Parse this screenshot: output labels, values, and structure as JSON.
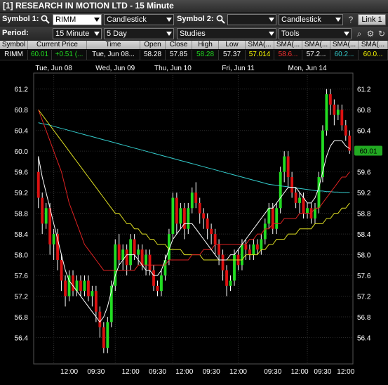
{
  "window": {
    "title": "[1] RESEARCH IN MOTION LTD - 15 Minute"
  },
  "toolbar": {
    "symbol1_label": "Symbol 1:",
    "symbol1_value": "RIMM",
    "chart_style1": "Candlestick",
    "symbol2_label": "Symbol 2:",
    "symbol2_value": "",
    "chart_style2": "Candlestick",
    "link_label": "Link 1",
    "period_label": "Period:",
    "period_value": "15 Minute",
    "range_value": "5 Day",
    "studies_value": "Studies",
    "tools_value": "Tools"
  },
  "quote_table": {
    "headers": [
      "Symbol",
      "Current Price",
      "Time",
      "Open",
      "Close",
      "High",
      "Low",
      "SMA(...",
      "SMA(...",
      "SMA(...",
      "SMA(...",
      "SMA(..."
    ],
    "row": [
      "RIMM",
      "60.01",
      "+0.51 (...",
      "Tue, Jun 08...",
      "58.28",
      "57.85",
      "58.28",
      "57.37",
      "57.014",
      "58.6...",
      "57.2...",
      "60.2...",
      "60.0..."
    ],
    "colors": {
      "symbol": "#ffffff",
      "price": "#22dd22",
      "change": "#22dd22",
      "time": "#ffffff",
      "open": "#ffffff",
      "close": "#ffffff",
      "high": "#22dd22",
      "low": "#ffffff",
      "sma1": "#ffff00",
      "sma2": "#ff3333",
      "sma3": "#ffffff",
      "sma4": "#33cccc",
      "sma5": "#ffff00"
    }
  },
  "chart_data": {
    "type": "candlestick",
    "y_ticks": [
      "61.2",
      "60.8",
      "60.4",
      "60.0",
      "59.6",
      "59.2",
      "58.8",
      "58.4",
      "58.0",
      "57.6",
      "57.2",
      "56.8",
      "56.4"
    ],
    "ylim": [
      56.0,
      61.4
    ],
    "top_date_labels": [
      "Tue, Jun 08",
      "Wed, Jun 09",
      "Thu, Jun 10",
      "Fri, Jun 11",
      "Mon, Jun 14"
    ],
    "bottom_time_labels": [
      "12:00",
      "09:30",
      "12:00",
      "09:30",
      "12:00",
      "09:30",
      "12:00",
      "09:30",
      "12:00",
      "09:30",
      "12:00"
    ],
    "last_price_label": "60.01",
    "colors": {
      "up": "#22dd22",
      "down": "#dd1111",
      "wick": "#ffffff",
      "grid": "#2a2a2a",
      "sma_white": "#ffffff",
      "sma_red": "#dd2222",
      "sma_yellow": "#dddd22",
      "sma_cyan": "#33cccc",
      "sma_yellow2": "#cccc22"
    },
    "candles": [
      [
        59.6,
        59.1,
        59.9,
        58.9
      ],
      [
        59.1,
        58.6,
        59.2,
        58.4
      ],
      [
        58.6,
        58.9,
        59.0,
        58.5
      ],
      [
        58.9,
        58.2,
        59.0,
        58.0
      ],
      [
        58.2,
        58.4,
        58.5,
        57.9
      ],
      [
        58.4,
        57.9,
        58.5,
        57.7
      ],
      [
        57.9,
        57.5,
        58.0,
        57.3
      ],
      [
        57.5,
        57.2,
        57.6,
        57.0
      ],
      [
        57.2,
        57.6,
        57.7,
        57.1
      ],
      [
        57.6,
        57.3,
        57.7,
        57.2
      ],
      [
        57.3,
        57.5,
        57.6,
        57.2
      ],
      [
        57.5,
        57.3,
        57.6,
        57.2
      ],
      [
        57.3,
        57.5,
        57.6,
        57.2
      ],
      [
        57.5,
        57.2,
        57.6,
        57.1
      ],
      [
        57.2,
        57.3,
        57.4,
        57.0
      ],
      [
        57.3,
        56.9,
        57.4,
        56.7
      ],
      [
        56.9,
        56.6,
        57.0,
        56.4
      ],
      [
        56.6,
        56.2,
        56.7,
        56.1
      ],
      [
        56.2,
        56.7,
        56.8,
        56.1
      ],
      [
        56.7,
        57.4,
        57.5,
        56.6
      ],
      [
        57.4,
        58.2,
        58.3,
        57.3
      ],
      [
        58.2,
        57.9,
        58.4,
        57.8
      ],
      [
        57.9,
        58.1,
        58.2,
        57.7
      ],
      [
        58.1,
        57.8,
        58.2,
        57.6
      ],
      [
        57.8,
        58.3,
        58.4,
        57.7
      ],
      [
        58.3,
        58.0,
        58.4,
        57.9
      ],
      [
        58.0,
        58.1,
        58.2,
        57.8
      ],
      [
        58.1,
        57.8,
        58.2,
        57.7
      ],
      [
        57.8,
        58.0,
        58.1,
        57.6
      ],
      [
        58.0,
        57.7,
        58.1,
        57.6
      ],
      [
        57.7,
        57.4,
        57.8,
        57.3
      ],
      [
        57.4,
        57.3,
        57.5,
        57.2
      ],
      [
        57.3,
        57.6,
        57.7,
        57.2
      ],
      [
        57.6,
        57.9,
        58.0,
        57.5
      ],
      [
        57.9,
        58.4,
        58.5,
        57.8
      ],
      [
        58.4,
        59.1,
        59.2,
        58.3
      ],
      [
        59.1,
        58.6,
        59.2,
        58.4
      ],
      [
        58.6,
        58.9,
        59.0,
        58.5
      ],
      [
        58.9,
        58.5,
        59.0,
        58.3
      ],
      [
        58.5,
        58.9,
        59.0,
        58.4
      ],
      [
        58.9,
        59.2,
        59.3,
        58.8
      ],
      [
        59.2,
        59.0,
        59.4,
        58.9
      ],
      [
        59.0,
        58.8,
        59.1,
        58.6
      ],
      [
        58.8,
        58.7,
        58.9,
        58.5
      ],
      [
        58.7,
        58.5,
        58.8,
        58.3
      ],
      [
        58.5,
        58.4,
        58.6,
        58.2
      ],
      [
        58.4,
        58.2,
        58.5,
        58.0
      ],
      [
        58.2,
        58.0,
        58.3,
        57.8
      ],
      [
        58.0,
        57.7,
        58.1,
        57.5
      ],
      [
        57.7,
        57.4,
        57.8,
        57.2
      ],
      [
        57.4,
        57.5,
        57.6,
        57.3
      ],
      [
        57.5,
        58.0,
        58.1,
        57.4
      ],
      [
        58.0,
        57.8,
        58.1,
        57.7
      ],
      [
        57.8,
        58.2,
        58.3,
        57.7
      ],
      [
        58.2,
        58.1,
        58.3,
        57.9
      ],
      [
        58.1,
        58.0,
        58.2,
        57.9
      ],
      [
        58.0,
        58.2,
        58.3,
        57.9
      ],
      [
        58.2,
        58.1,
        58.3,
        58.0
      ],
      [
        58.1,
        58.3,
        58.4,
        58.0
      ],
      [
        58.3,
        58.6,
        58.7,
        58.2
      ],
      [
        58.6,
        58.9,
        59.0,
        58.5
      ],
      [
        58.9,
        58.5,
        59.0,
        58.4
      ],
      [
        58.5,
        58.9,
        59.0,
        58.4
      ],
      [
        58.9,
        59.6,
        59.7,
        58.8
      ],
      [
        59.6,
        59.9,
        60.0,
        59.4
      ],
      [
        59.9,
        59.5,
        60.0,
        59.3
      ],
      [
        59.5,
        59.2,
        59.6,
        59.1
      ],
      [
        59.2,
        59.0,
        59.3,
        58.9
      ],
      [
        59.0,
        59.1,
        59.2,
        58.8
      ],
      [
        59.1,
        58.8,
        59.2,
        58.7
      ],
      [
        58.8,
        58.9,
        59.0,
        58.7
      ],
      [
        58.9,
        58.7,
        59.0,
        58.6
      ],
      [
        58.7,
        58.9,
        59.0,
        58.6
      ],
      [
        58.9,
        59.5,
        59.6,
        58.8
      ],
      [
        59.5,
        60.4,
        60.5,
        59.4
      ],
      [
        60.4,
        61.1,
        61.2,
        60.3
      ],
      [
        61.1,
        60.9,
        61.2,
        60.7
      ],
      [
        60.9,
        60.7,
        61.0,
        60.5
      ],
      [
        60.7,
        60.8,
        60.9,
        60.6
      ],
      [
        60.8,
        60.5,
        60.9,
        60.4
      ],
      [
        60.5,
        60.3,
        60.6,
        60.2
      ],
      [
        60.3,
        60.01,
        60.4,
        59.95
      ]
    ],
    "sma_white": [
      59.9,
      59.5,
      59.2,
      58.9,
      58.6,
      58.3,
      58.0,
      57.7,
      57.5,
      57.4,
      57.3,
      57.2,
      57.1,
      57.0,
      56.9,
      56.8,
      56.7,
      56.8,
      57.0,
      57.3,
      57.6,
      57.8,
      57.9,
      58.0,
      58.0,
      58.0,
      57.9,
      57.8,
      57.7,
      57.7,
      57.6,
      57.6,
      57.7,
      57.9,
      58.1,
      58.3,
      58.4,
      58.5,
      58.6,
      58.6,
      58.6,
      58.5,
      58.4,
      58.3,
      58.2,
      58.1,
      58.0,
      57.9,
      57.9,
      57.9,
      58.0,
      58.0,
      58.1,
      58.2,
      58.3,
      58.4,
      58.5,
      58.6,
      58.7,
      58.8,
      58.9,
      58.9,
      59.0,
      59.1,
      59.2,
      59.3,
      59.3,
      59.3,
      59.2,
      59.1,
      59.0,
      59.0,
      59.1,
      59.3,
      59.6,
      59.9,
      60.1,
      60.2,
      60.2,
      60.2,
      60.1,
      60.05
    ],
    "sma_red": [
      60.8,
      60.6,
      60.4,
      60.2,
      60.0,
      59.8,
      59.6,
      59.3,
      59.0,
      58.8,
      58.6,
      58.4,
      58.2,
      58.1,
      58.0,
      57.9,
      57.8,
      57.7,
      57.7,
      57.7,
      57.7,
      57.7,
      57.7,
      57.7,
      57.7,
      57.7,
      57.8,
      57.8,
      57.8,
      57.8,
      57.8,
      57.8,
      57.8,
      57.8,
      57.9,
      57.9,
      57.9,
      57.9,
      57.9,
      57.9,
      58.0,
      58.0,
      58.0,
      58.1,
      58.1,
      58.1,
      58.2,
      58.2,
      58.2,
      58.2,
      58.2,
      58.2,
      58.2,
      58.2,
      58.2,
      58.3,
      58.3,
      58.4,
      58.4,
      58.5,
      58.5,
      58.6,
      58.6,
      58.6,
      58.7,
      58.7,
      58.7,
      58.7,
      58.8,
      58.8,
      58.8,
      58.8,
      58.9,
      58.9,
      59.0,
      59.1,
      59.2,
      59.3,
      59.4,
      59.5,
      59.5,
      59.6
    ],
    "sma_yellow": [
      60.8,
      60.7,
      60.6,
      60.5,
      60.4,
      60.3,
      60.2,
      60.1,
      60.0,
      59.9,
      59.8,
      59.7,
      59.6,
      59.5,
      59.4,
      59.3,
      59.2,
      59.1,
      59.0,
      58.9,
      58.8,
      58.8,
      58.7,
      58.6,
      58.6,
      58.5,
      58.5,
      58.4,
      58.4,
      58.3,
      58.3,
      58.2,
      58.2,
      58.2,
      58.1,
      58.1,
      58.1,
      58.1,
      58.0,
      58.0,
      58.0,
      58.0,
      58.0,
      57.9,
      57.9,
      57.9,
      57.9,
      57.9,
      57.9,
      57.9,
      57.9,
      57.9,
      57.9,
      57.9,
      58.0,
      58.0,
      58.0,
      58.0,
      58.1,
      58.1,
      58.2,
      58.2,
      58.3,
      58.3,
      58.3,
      58.4,
      58.4,
      58.4,
      58.5,
      58.5,
      58.5,
      58.5,
      58.6,
      58.6,
      58.6,
      58.7,
      58.7,
      58.8,
      58.8,
      58.9,
      58.9,
      59.0
    ],
    "sma_cyan": [
      60.55,
      60.53,
      60.52,
      60.5,
      60.48,
      60.46,
      60.44,
      60.42,
      60.4,
      60.38,
      60.36,
      60.34,
      60.32,
      60.3,
      60.28,
      60.26,
      60.24,
      60.22,
      60.2,
      60.18,
      60.16,
      60.14,
      60.12,
      60.1,
      60.08,
      60.06,
      60.04,
      60.02,
      60.0,
      59.98,
      59.96,
      59.94,
      59.92,
      59.9,
      59.88,
      59.86,
      59.84,
      59.82,
      59.8,
      59.78,
      59.76,
      59.74,
      59.72,
      59.7,
      59.68,
      59.66,
      59.64,
      59.62,
      59.6,
      59.58,
      59.56,
      59.54,
      59.52,
      59.5,
      59.48,
      59.46,
      59.44,
      59.42,
      59.4,
      59.38,
      59.36,
      59.35,
      59.34,
      59.33,
      59.32,
      59.31,
      59.3,
      59.29,
      59.28,
      59.27,
      59.26,
      59.25,
      59.24,
      59.23,
      59.23,
      59.22,
      59.22,
      59.21,
      59.21,
      59.2,
      59.2,
      59.2
    ]
  }
}
